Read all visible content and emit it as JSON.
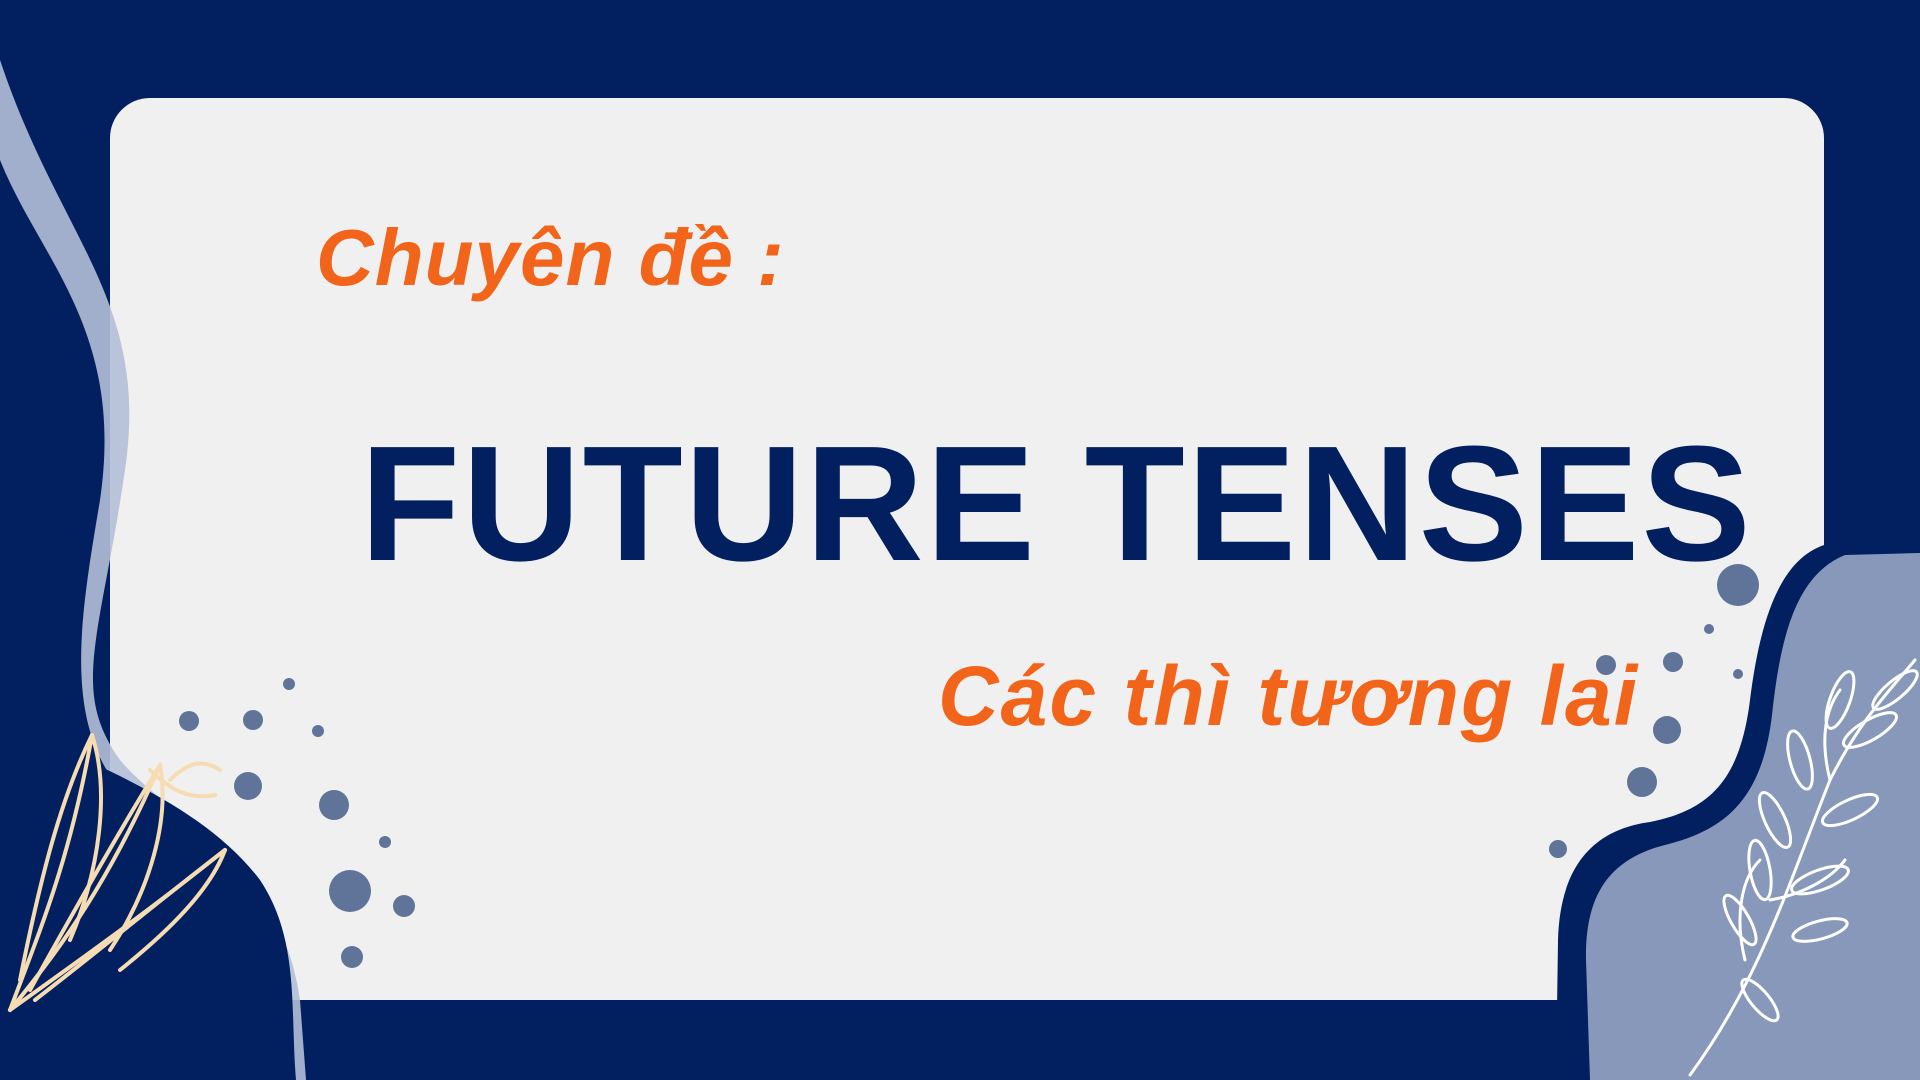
{
  "slide": {
    "subtitle": "Chuyên đề :",
    "title": "FUTURE TENSES",
    "caption": "Các thì tương lai"
  },
  "colors": {
    "background": "#022060",
    "card": "#f0f0f0",
    "accent_orange": "#f26419",
    "title_navy": "#022060",
    "dot_blue": "#5f7498",
    "blob_blue": "#8798ba",
    "swirl_light": "#b3bfd8",
    "leaf_cream": "#f6dcb2"
  },
  "decorations": {
    "left_icon": "leaf-sprig-icon",
    "right_icon": "leafy-branch-icon"
  }
}
